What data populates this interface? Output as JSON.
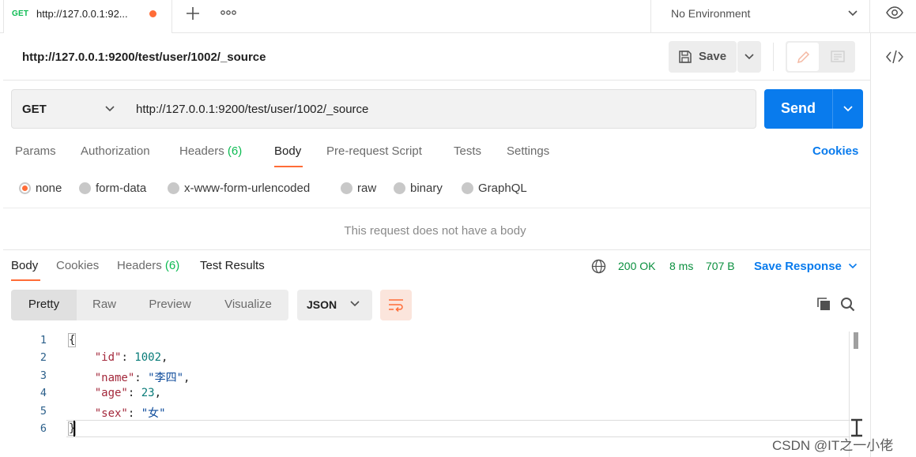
{
  "tab": {
    "method": "GET",
    "title": "http://127.0.0.1:92...",
    "unsaved_color": "#ff6c37"
  },
  "tabbar": {
    "new_tab_icon": "plus-icon",
    "more_icon": "ellipsis-icon"
  },
  "environment": {
    "label": "No Environment"
  },
  "request": {
    "title": "http://127.0.0.1:9200/test/user/1002/_source",
    "save_label": "Save",
    "method": "GET",
    "url": "http://127.0.0.1:9200/test/user/1002/_source",
    "send_label": "Send"
  },
  "request_tabs": [
    {
      "label": "Params",
      "count": ""
    },
    {
      "label": "Authorization",
      "count": ""
    },
    {
      "label": "Headers",
      "count": "(6)"
    },
    {
      "label": "Body",
      "count": "",
      "active": true
    },
    {
      "label": "Pre-request Script",
      "count": ""
    },
    {
      "label": "Tests",
      "count": ""
    },
    {
      "label": "Settings",
      "count": ""
    }
  ],
  "cookies_label": "Cookies",
  "body_types": [
    {
      "label": "none",
      "selected": true
    },
    {
      "label": "form-data"
    },
    {
      "label": "x-www-form-urlencoded"
    },
    {
      "label": "raw"
    },
    {
      "label": "binary"
    },
    {
      "label": "GraphQL"
    }
  ],
  "no_body_message": "This request does not have a body",
  "response": {
    "tabs": [
      {
        "label": "Body",
        "count": "",
        "active": true
      },
      {
        "label": "Cookies",
        "count": ""
      },
      {
        "label": "Headers",
        "count": "(6)"
      },
      {
        "label": "Test Results",
        "count": ""
      }
    ],
    "status": "200 OK",
    "time": "8 ms",
    "size": "707 B",
    "save_response_label": "Save Response",
    "view_modes": [
      "Pretty",
      "Raw",
      "Preview",
      "Visualize"
    ],
    "active_view_mode": "Pretty",
    "format": "JSON",
    "line_numbers": [
      "1",
      "2",
      "3",
      "4",
      "5",
      "6"
    ],
    "code": {
      "open": "{",
      "close": "}",
      "fields": [
        {
          "key": "\"id\"",
          "value": "1002",
          "value_type": "number",
          "sep": ": ",
          "trail": ","
        },
        {
          "key": "\"name\"",
          "value": "\"李四\"",
          "value_type": "string",
          "sep": ": ",
          "trail": ","
        },
        {
          "key": "\"age\"",
          "value": "23",
          "value_type": "number",
          "sep": ": ",
          "trail": ","
        },
        {
          "key": "\"sex\"",
          "value": "\"女\"",
          "value_type": "string",
          "sep": ": ",
          "trail": ""
        }
      ]
    }
  },
  "watermark": "CSDN @IT之一小佬",
  "colors": {
    "accent": "#ff6c37",
    "send": "#097bed",
    "success": "#0cbb52"
  }
}
